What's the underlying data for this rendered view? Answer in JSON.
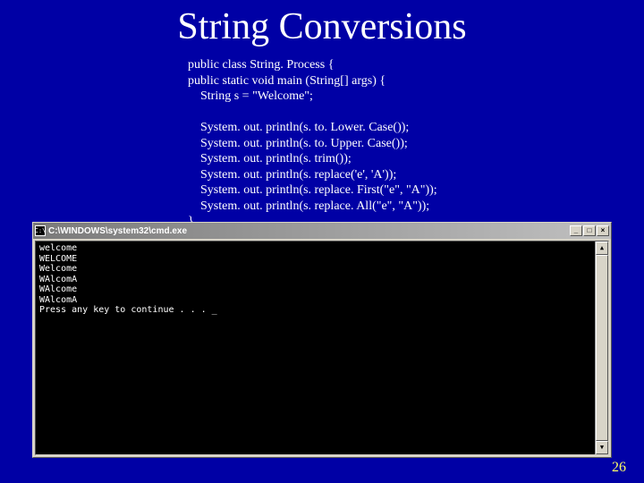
{
  "title": "String Conversions",
  "code": {
    "l1": "public class String. Process {",
    "l2": "public static void main (String[] args) {",
    "l3": "String s = \"Welcome\";",
    "l4": "System. out. println(s. to. Lower. Case());",
    "l5": "System. out. println(s. to. Upper. Case());",
    "l6": "System. out. println(s. trim());",
    "l7": "System. out. println(s. replace('e', 'A'));",
    "l8": "System. out. println(s. replace. First(\"e\", \"A\"));",
    "l9": "System. out. println(s. replace. All(\"e\", \"A\"));",
    "l10": "}",
    "l11": "}"
  },
  "window": {
    "icon_text": "C:\\",
    "title": "C:\\WINDOWS\\system32\\cmd.exe",
    "min": "_",
    "max": "□",
    "close": "×"
  },
  "console": {
    "o1": "welcome",
    "o2": "WELCOME",
    "o3": "Welcome",
    "o4": "WAlcomA",
    "o5": "WAlcome",
    "o6": "WAlcomA",
    "o7": "Press any key to continue . . . _"
  },
  "page_number": "26"
}
